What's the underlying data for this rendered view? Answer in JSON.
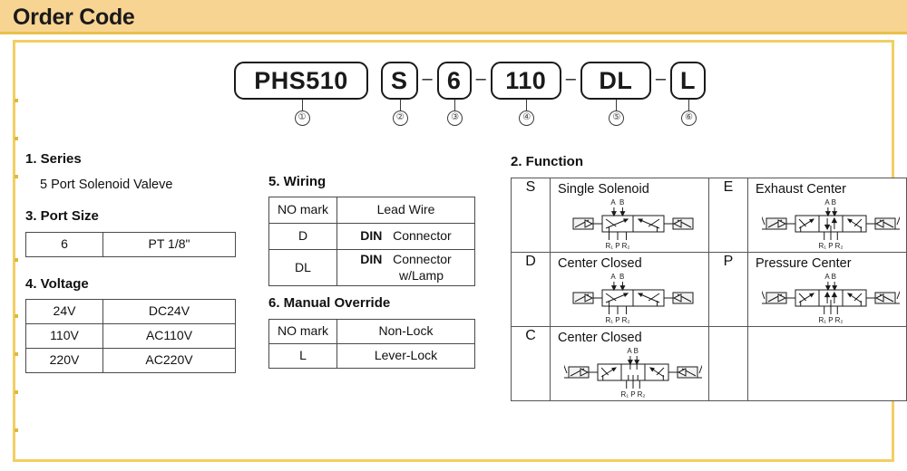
{
  "header": {
    "title": "Order Code"
  },
  "order_code": {
    "segments": [
      {
        "text": "PHS510",
        "num": "①",
        "size": "wide"
      },
      {
        "text": "S",
        "num": "②",
        "size": "narrow"
      },
      {
        "text": "6",
        "num": "③",
        "size": "narrow"
      },
      {
        "text": "110",
        "num": "④",
        "size": "mid"
      },
      {
        "text": "DL",
        "num": "⑤",
        "size": "mid"
      },
      {
        "text": "L",
        "num": "⑥",
        "size": "narrow"
      }
    ],
    "separator": "–"
  },
  "sections": {
    "series": {
      "heading": "1. Series",
      "value": "5 Port Solenoid Valeve"
    },
    "port_size": {
      "heading": "3. Port Size",
      "rows": [
        {
          "code": "6",
          "desc": "PT  1/8\""
        }
      ]
    },
    "voltage": {
      "heading": "4. Voltage",
      "rows": [
        {
          "code": "24V",
          "desc": "DC24V"
        },
        {
          "code": "110V",
          "desc": "AC110V"
        },
        {
          "code": "220V",
          "desc": "AC220V"
        }
      ]
    },
    "wiring": {
      "heading": "5. Wiring",
      "rows": [
        {
          "code": "NO  mark",
          "desc": "Lead Wire",
          "bold_prefix": ""
        },
        {
          "code": "D",
          "desc": "Connector",
          "bold_prefix": "DIN"
        },
        {
          "code": "DL",
          "desc": "Connector\nw/Lamp",
          "bold_prefix": "DIN"
        }
      ]
    },
    "manual_override": {
      "heading": "6. Manual Override",
      "rows": [
        {
          "code": "NO  mark",
          "desc": "Non-Lock"
        },
        {
          "code": "L",
          "desc": "Lever-Lock"
        }
      ]
    },
    "function": {
      "heading": "2. Function",
      "port_labels_top": "A B",
      "port_labels_bottom": "R₁ P R₂",
      "entries": [
        {
          "code": "S",
          "name": "Single Solenoid",
          "symbol": "2pos-single",
          "column": "left"
        },
        {
          "code": "D",
          "name": "Center Closed",
          "symbol": "2pos-single",
          "column": "left"
        },
        {
          "code": "C",
          "name": "Center Closed",
          "symbol": "3pos-closed",
          "column": "left"
        },
        {
          "code": "E",
          "name": "Exhaust Center",
          "symbol": "3pos-exhaust",
          "column": "right"
        },
        {
          "code": "P",
          "name": "Pressure Center",
          "symbol": "3pos-pressure",
          "column": "right"
        }
      ]
    }
  },
  "colors": {
    "header_bg": "#f8d493",
    "header_rule": "#e8c14a",
    "frame_border": "#f2cf63",
    "text": "#1a1a1a",
    "table_border": "#4a4a4a"
  }
}
